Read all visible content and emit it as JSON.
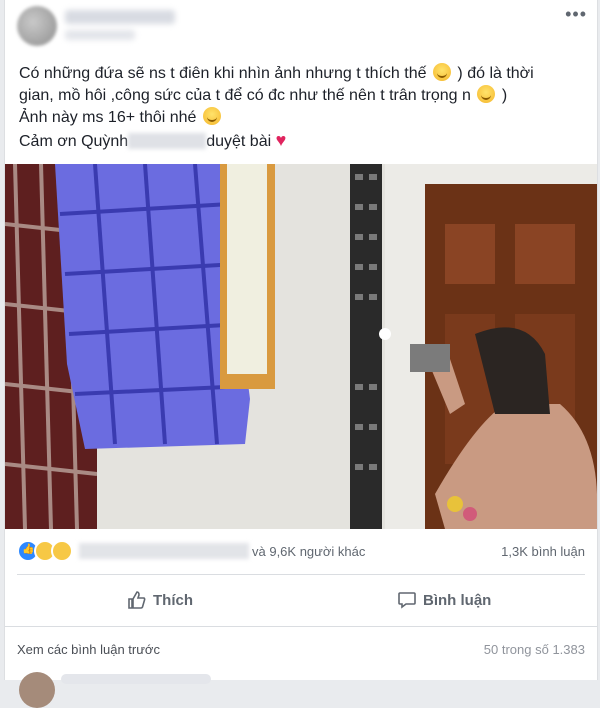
{
  "post": {
    "more_label": "•••",
    "text_lines": [
      "Có những đứa sẽ ns t điên khi nhìn ảnh nhưng t thích thế",
      ") đó là thời",
      "gian, mồ hôi ,công sức của t để có đc như thế nên t trân trọng n",
      ")",
      "Ảnh này ms 16+ thôi nhé",
      "Cảm ơn Quỳnh",
      "duyệt bài"
    ],
    "heart": "♥"
  },
  "stats": {
    "others": "và 9,6K người khác",
    "comments": "1,3K bình luận"
  },
  "actions": {
    "like": "Thích",
    "comment": "Bình luận"
  },
  "comments": {
    "prev_label": "Xem các bình luận trước",
    "paging": "50 trong số 1.383"
  },
  "icons": {
    "like": "like-icon",
    "comment": "comment-icon",
    "reactions": [
      "like-reaction-icon",
      "haha-reaction-icon",
      "wow-reaction-icon"
    ]
  },
  "colors": {
    "accent": "#2d88ff",
    "heart": "#e0245e"
  }
}
